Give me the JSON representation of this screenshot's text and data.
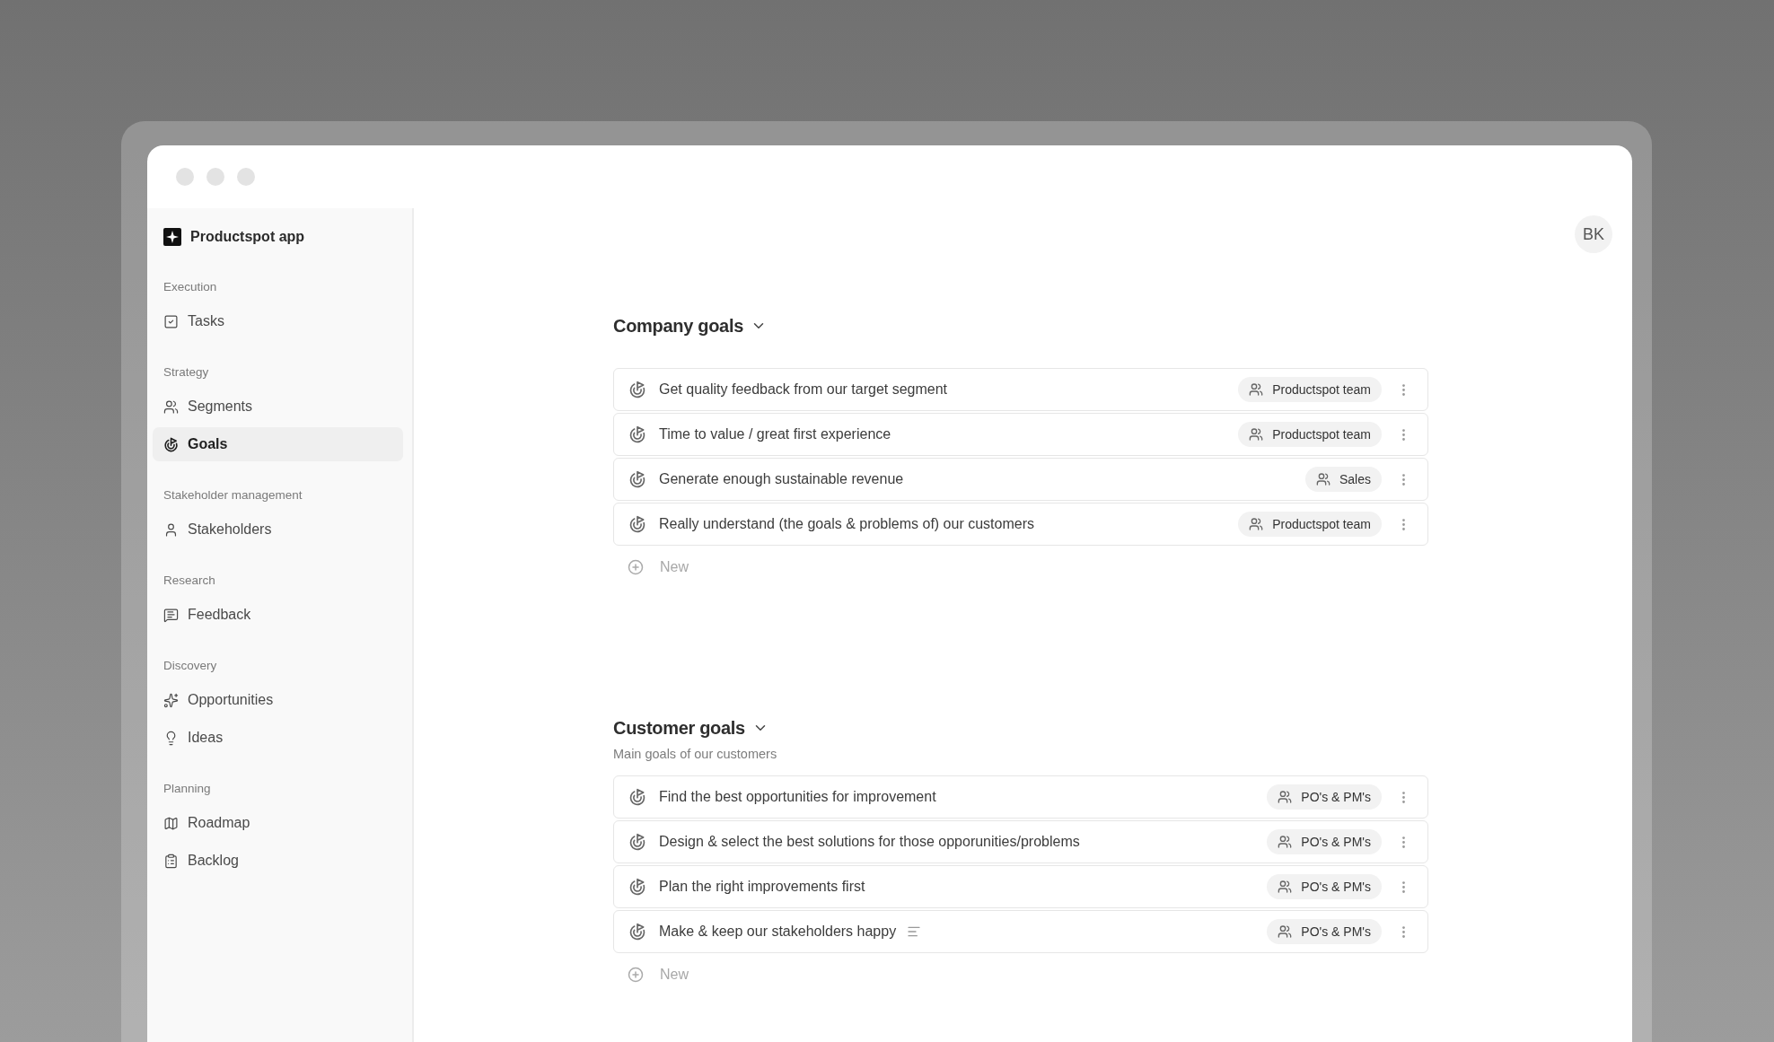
{
  "sidebar": {
    "app_name": "Productspot app",
    "sections": [
      {
        "title": "Execution",
        "items": [
          {
            "label": "Tasks",
            "selected": false
          }
        ]
      },
      {
        "title": "Strategy",
        "items": [
          {
            "label": "Segments",
            "selected": false
          },
          {
            "label": "Goals",
            "selected": true
          }
        ]
      },
      {
        "title": "Stakeholder management",
        "items": [
          {
            "label": "Stakeholders",
            "selected": false
          }
        ]
      },
      {
        "title": "Research",
        "items": [
          {
            "label": "Feedback",
            "selected": false
          }
        ]
      },
      {
        "title": "Discovery",
        "items": [
          {
            "label": "Opportunities",
            "selected": false
          },
          {
            "label": "Ideas",
            "selected": false
          }
        ]
      },
      {
        "title": "Planning",
        "items": [
          {
            "label": "Roadmap",
            "selected": false
          },
          {
            "label": "Backlog",
            "selected": false
          }
        ]
      }
    ]
  },
  "avatar": "BK",
  "groups": [
    {
      "title": "Company goals",
      "goals": [
        {
          "title": "Get quality feedback from our target segment",
          "team": "Productspot team",
          "has_notes": false
        },
        {
          "title": "Time to value / great first experience",
          "team": "Productspot team",
          "has_notes": false
        },
        {
          "title": "Generate enough sustainable revenue",
          "team": "Sales",
          "has_notes": false
        },
        {
          "title": "Really understand (the goals & problems of) our customers",
          "team": "Productspot team",
          "has_notes": false
        }
      ],
      "new_label": "New"
    },
    {
      "title": "Customer goals",
      "description": "Main goals of our customers",
      "goals": [
        {
          "title": "Find the best opportunities for improvement",
          "team": "PO's & PM's",
          "has_notes": false
        },
        {
          "title": "Design & select the best solutions for those opporunities/problems",
          "team": "PO's & PM's",
          "has_notes": false
        },
        {
          "title": "Plan the right improvements first",
          "team": "PO's & PM's",
          "has_notes": false
        },
        {
          "title": "Make & keep our stakeholders happy",
          "team": "PO's & PM's",
          "has_notes": true
        }
      ],
      "new_label": "New"
    }
  ]
}
